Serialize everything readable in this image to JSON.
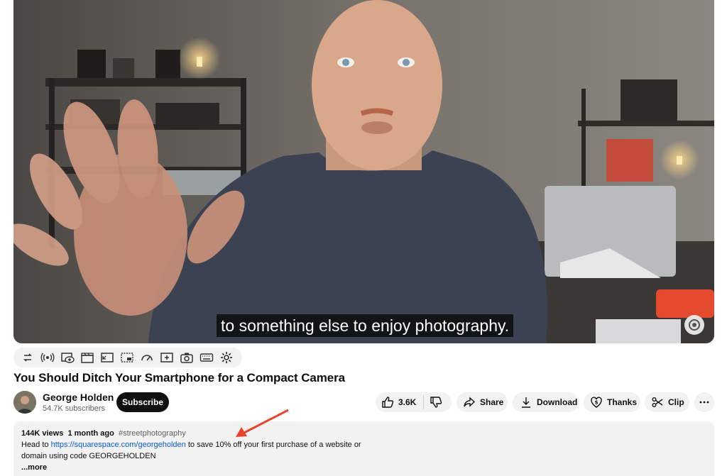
{
  "player": {
    "caption": "to something else to enjoy photography."
  },
  "extension_toolbar": {
    "icons": [
      "repeat-icon",
      "cast-icon",
      "eye-icon",
      "clapperboard-icon",
      "aspect-ratio-icon",
      "mini-player-icon",
      "speed-gauge-icon",
      "add-frame-icon",
      "screenshot-camera-icon",
      "keyboard-icon",
      "settings-gear-icon"
    ]
  },
  "video": {
    "title": "You Should Ditch Your Smartphone for a Compact Camera"
  },
  "channel": {
    "name": "George Holden",
    "subscribers": "54.7K subscribers",
    "subscribe_label": "Subscribe"
  },
  "actions": {
    "likes": "3.6K",
    "share": "Share",
    "download": "Download",
    "thanks": "Thanks",
    "clip": "Clip",
    "more": "..."
  },
  "description": {
    "views": "144K views",
    "age": "1 month ago",
    "hashtag": "#streetphotography",
    "text_before": "Head to ",
    "link": "https://squarespace.com/georgeholden",
    "text_after": " to save 10% off your first purchase of a website or domain using code GEORGEHOLDEN",
    "more": "...more"
  },
  "colors": {
    "annotation_arrow": "#e8442c",
    "link": "#065fd4",
    "subscribe_bg": "#0f0f0f"
  }
}
